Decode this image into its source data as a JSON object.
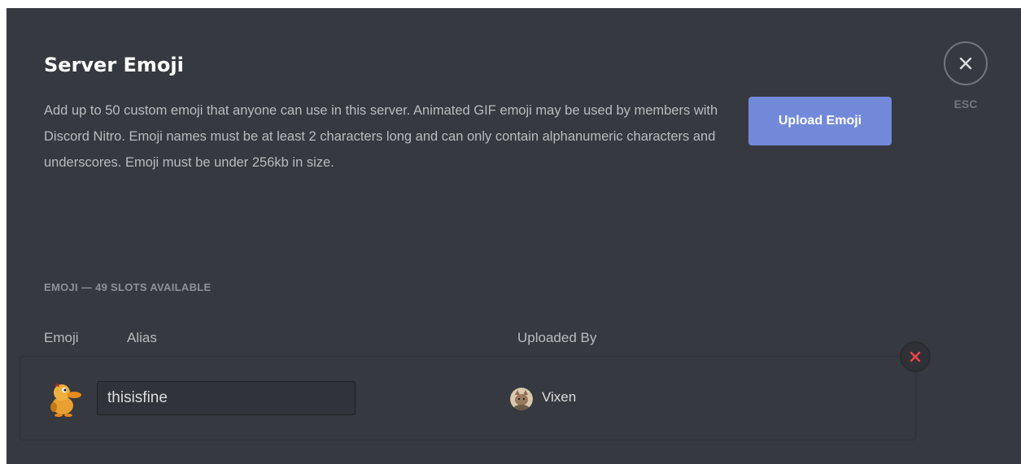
{
  "header": {
    "title": "Server Emoji",
    "description": "Add up to 50 custom emoji that anyone can use in this server. Animated GIF emoji may be used by members with Discord Nitro. Emoji names must be at least 2 characters long and can only contain alphanumeric characters and underscores. Emoji must be under 256kb in size.",
    "upload_label": "Upload Emoji",
    "close_icon": "close-icon",
    "esc_label": "ESC"
  },
  "section": {
    "header": "EMOJI — 49 SLOTS AVAILABLE"
  },
  "table": {
    "columns": [
      "Emoji",
      "Alias",
      "Uploaded By"
    ],
    "rows": [
      {
        "emoji_icon": "duck-emoji-icon",
        "alias": "thisisfine",
        "uploader_avatar_icon": "avatar-icon",
        "uploader": "Vixen",
        "remove_icon": "remove-icon"
      }
    ]
  },
  "colors": {
    "background": "#36393f",
    "accent": "#7289da",
    "danger": "#f04747",
    "title": "#ffffff",
    "muted": "#8e9297"
  }
}
